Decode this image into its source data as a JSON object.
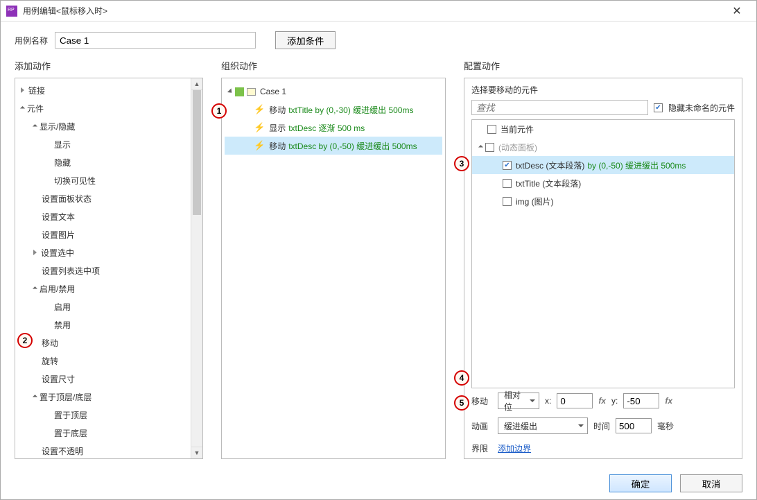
{
  "window": {
    "title": "用例编辑<鼠标移入时>"
  },
  "nameRow": {
    "label": "用例名称",
    "value": "Case 1",
    "addConditionBtn": "添加条件"
  },
  "columns": {
    "actionsTitle": "添加动作",
    "orgTitle": "组织动作",
    "configTitle": "配置动作"
  },
  "actionsTree": [
    {
      "label": "链接",
      "indent": 0,
      "arrow": "▶"
    },
    {
      "label": "元件",
      "indent": 0,
      "arrow": "▲"
    },
    {
      "label": "显示/隐藏",
      "indent": 1,
      "arrow": "▲"
    },
    {
      "label": "显示",
      "indent": 2,
      "arrow": ""
    },
    {
      "label": "隐藏",
      "indent": 2,
      "arrow": ""
    },
    {
      "label": "切换可见性",
      "indent": 2,
      "arrow": ""
    },
    {
      "label": "设置面板状态",
      "indent": 1,
      "arrow": ""
    },
    {
      "label": "设置文本",
      "indent": 1,
      "arrow": ""
    },
    {
      "label": "设置图片",
      "indent": 1,
      "arrow": ""
    },
    {
      "label": "设置选中",
      "indent": 1,
      "arrow": "▷"
    },
    {
      "label": "设置列表选中项",
      "indent": 1,
      "arrow": ""
    },
    {
      "label": "启用/禁用",
      "indent": 1,
      "arrow": "▲"
    },
    {
      "label": "启用",
      "indent": 2,
      "arrow": ""
    },
    {
      "label": "禁用",
      "indent": 2,
      "arrow": ""
    },
    {
      "label": "移动",
      "indent": 1,
      "arrow": ""
    },
    {
      "label": "旋转",
      "indent": 1,
      "arrow": ""
    },
    {
      "label": "设置尺寸",
      "indent": 1,
      "arrow": ""
    },
    {
      "label": "置于顶层/底层",
      "indent": 1,
      "arrow": "▲"
    },
    {
      "label": "置于顶层",
      "indent": 2,
      "arrow": ""
    },
    {
      "label": "置于底层",
      "indent": 2,
      "arrow": ""
    },
    {
      "label": "设置不透明",
      "indent": 1,
      "arrow": ""
    }
  ],
  "orgCase": {
    "caseName": "Case 1",
    "rows": [
      {
        "action": "移动",
        "target": "txtTitle by (0,-30) 缓进缓出 500ms",
        "selected": false
      },
      {
        "action": "显示",
        "target": "txtDesc 逐渐 500 ms",
        "selected": false
      },
      {
        "action": "移动",
        "target": "txtDesc by (0,-50) 缓进缓出 500ms",
        "selected": true
      }
    ]
  },
  "config": {
    "sectionTitle": "选择要移动的元件",
    "searchPlaceholder": "查找",
    "hideUnnamedLabel": "隐藏未命名的元件",
    "hideUnnamedChecked": true,
    "widgets": [
      {
        "indent": 0,
        "checked": false,
        "label": "当前元件",
        "muted": false,
        "arrow": ""
      },
      {
        "indent": 0,
        "checked": false,
        "label": "(动态面板)",
        "muted": true,
        "arrow": "▲"
      },
      {
        "indent": 1,
        "checked": true,
        "label": "txtDesc (文本段落)",
        "muted": false,
        "detail": "by (0,-50) 缓进缓出 500ms",
        "selected": true,
        "arrow": ""
      },
      {
        "indent": 1,
        "checked": false,
        "label": "txtTitle (文本段落)",
        "muted": false,
        "arrow": ""
      },
      {
        "indent": 1,
        "checked": false,
        "label": "img (图片)",
        "muted": false,
        "arrow": ""
      }
    ],
    "moveLabel": "移动",
    "moveMode": "相对位",
    "xLabel": "x:",
    "xValue": "0",
    "yLabel": "y:",
    "yValue": "-50",
    "animLabel": "动画",
    "animValue": "缓进缓出",
    "timeLabel": "时间",
    "timeValue": "500",
    "timeUnit": "毫秒",
    "boundsLabel": "界限",
    "boundsLink": "添加边界"
  },
  "footer": {
    "ok": "确定",
    "cancel": "取消"
  },
  "callouts": {
    "c1": "1",
    "c2": "2",
    "c3": "3",
    "c4": "4",
    "c5": "5"
  }
}
